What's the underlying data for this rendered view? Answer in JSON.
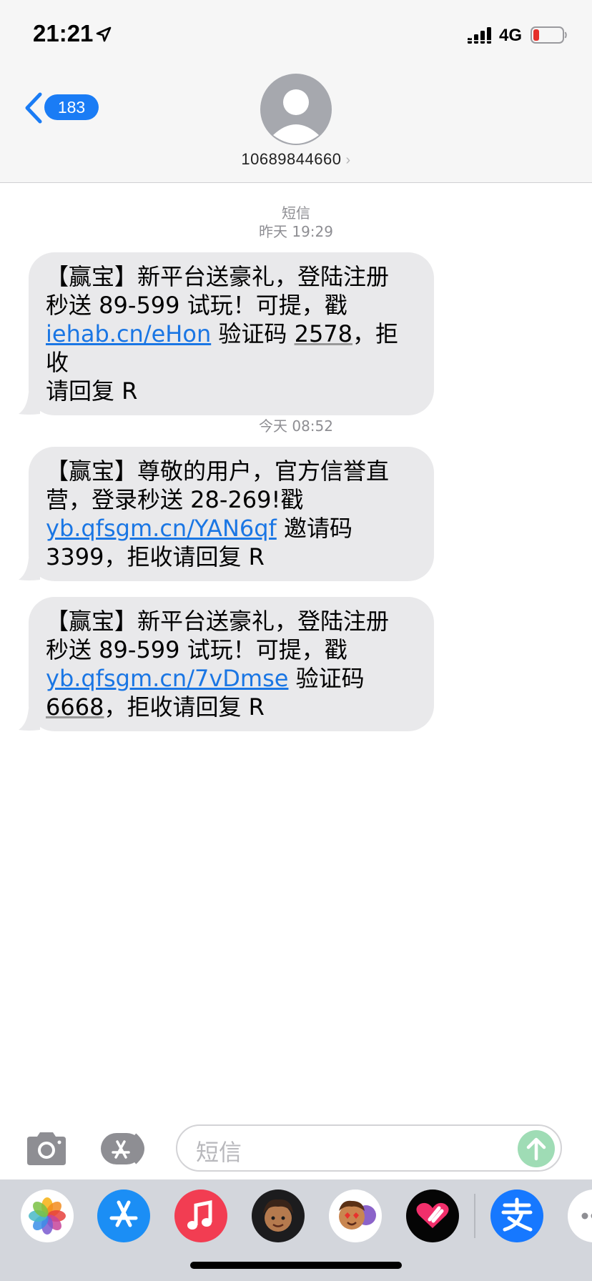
{
  "status_bar": {
    "time": "21:21",
    "network": "4G"
  },
  "header": {
    "back_badge": "183",
    "contact": "10689844660",
    "contact_chevron": "›"
  },
  "conversation": {
    "service_label": "短信",
    "timestamp_1": "昨天 19:29",
    "timestamp_2": "今天 08:52",
    "messages": [
      {
        "line1": "【赢宝】新平台送豪礼，登陆注册",
        "line2": "秒送 89-599 试玩！可提，戳",
        "link": "iehab.cn/eHon",
        "after_link": " 验证码 ",
        "code": "2578",
        "after_code": "，拒收",
        "line4": "请回复 R"
      },
      {
        "line1": "【赢宝】尊敬的用户，官方信誉直",
        "line2": "营，登录秒送 28-269!戳",
        "link": "yb.qfsgm.cn/YAN6qf",
        "after_link": " 邀请码",
        "line4_code": "3399",
        "line4_rest": "，拒收请回复 R"
      },
      {
        "line1": "【赢宝】新平台送豪礼，登陆注册",
        "line2": "秒送 89-599 试玩！可提，戳",
        "link": "yb.qfsgm.cn/7vDmse",
        "after_link": " 验证码",
        "line4_code": "6668",
        "line4_rest": "，拒收请回复 R"
      }
    ]
  },
  "compose": {
    "placeholder": "短信"
  },
  "app_drawer": {
    "icons": [
      "photos-icon",
      "app-store-icon",
      "music-icon",
      "memoji-icon",
      "memoji-stickers-icon",
      "digital-touch-icon",
      "alipay-icon",
      "more-icon"
    ]
  },
  "colors": {
    "accent": "#1a7cf5",
    "bubble": "#e9e9eb",
    "link": "#1a76e4",
    "send_button": "#9fdcb5"
  }
}
